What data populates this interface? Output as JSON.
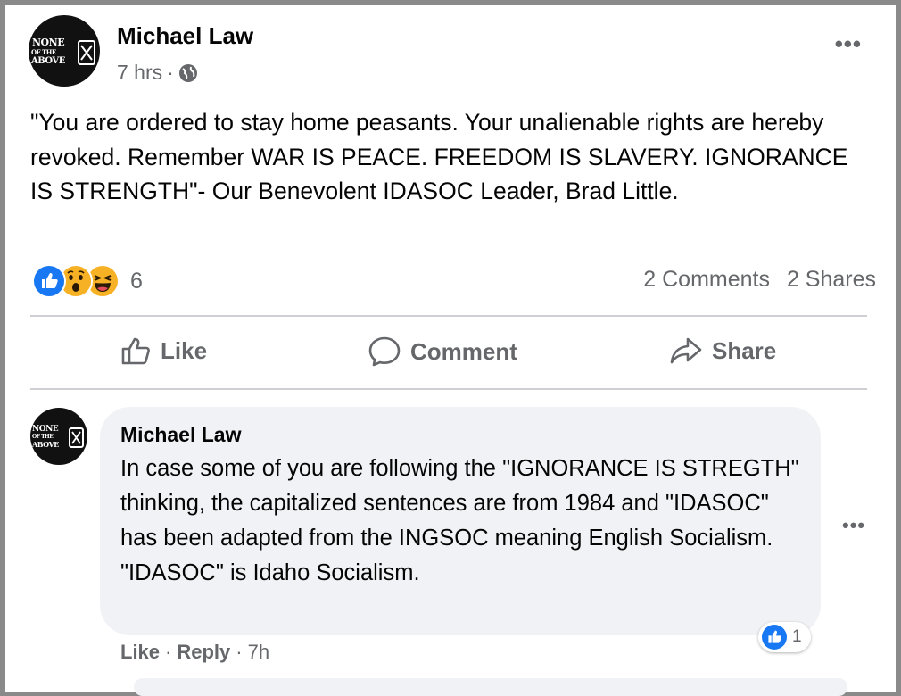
{
  "post": {
    "author": "Michael Law",
    "time": "7 hrs",
    "dot": "·",
    "more": "•••",
    "text": "\"You are ordered to stay home peasants. Your unalienable rights are hereby revoked. Remember WAR IS PEACE. FREEDOM IS SLAVERY. IGNORANCE IS STRENGTH\"- Our Benevolent IDASOC Leader, Brad Little.",
    "avatar": {
      "line1": "NONE",
      "line2": "OF THE",
      "line3": "ABOVE"
    },
    "reaction_icons": [
      "like-icon",
      "wow-icon",
      "haha-icon"
    ],
    "reaction_count": "6",
    "comments_count": "2 Comments",
    "shares_count": "2 Shares",
    "actions": {
      "like": "Like",
      "comment": "Comment",
      "share": "Share"
    }
  },
  "comment": {
    "author": "Michael Law",
    "text": "In case some of you are following the \"IGNORANCE IS STREGTH\" thinking, the capitalized sentences are from 1984 and \"IDASOC\" has been adapted from the INGSOC meaning English Socialism. \"IDASOC\" is Idaho Socialism.",
    "more": "•••",
    "reaction_count": "1",
    "like": "Like",
    "reply": "Reply",
    "time": "7h",
    "dot": "·"
  },
  "colors": {
    "secondary_text": "#65676b",
    "like_blue": "#1877f2",
    "bubble": "#f0f2f5",
    "divider": "#ced0d4"
  }
}
